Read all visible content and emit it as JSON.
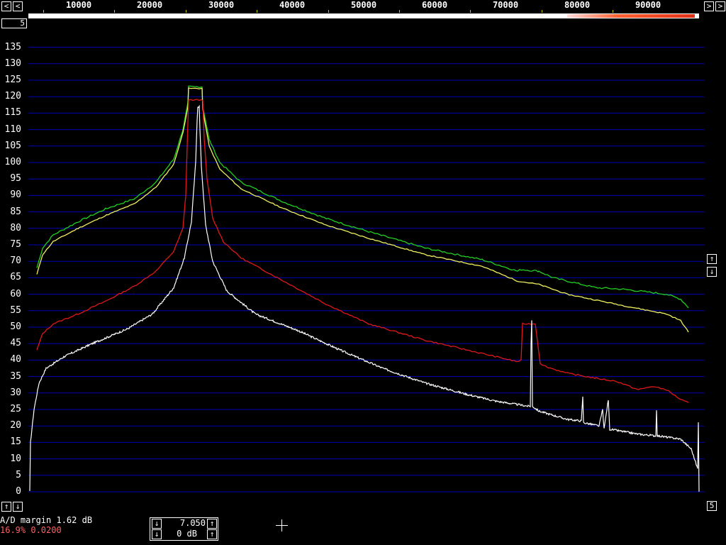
{
  "ruler": {
    "ticks": [
      "10000",
      "20000",
      "30000",
      "40000",
      "50000",
      "60000",
      "70000",
      "80000",
      "90000"
    ]
  },
  "top_left_value": "5",
  "right_value": "5",
  "y_axis": {
    "labels": [
      "135",
      "130",
      "125",
      "120",
      "115",
      "110",
      "105",
      "100",
      "95",
      "90",
      "85",
      "80",
      "75",
      "70",
      "65",
      "60",
      "55",
      "50",
      "45",
      "40",
      "35",
      "30",
      "25",
      "20",
      "15",
      "10",
      "5",
      "0"
    ]
  },
  "status": {
    "ad_margin": "A/D margin 1.62 dB",
    "level": "16.9% 0.0200"
  },
  "controls": {
    "value_top": "7.050",
    "value_bottom": "0 dB"
  },
  "icons": {
    "left_arrow": "<",
    "right_arrow": ">",
    "up_arrow": "↑",
    "down_arrow": "↓"
  },
  "colors": {
    "grid": "#0000b4",
    "green": "#22d022",
    "yellow": "#f0f060",
    "red": "#e01818",
    "white": "#ffffff",
    "red_text": "#ff6060"
  }
}
